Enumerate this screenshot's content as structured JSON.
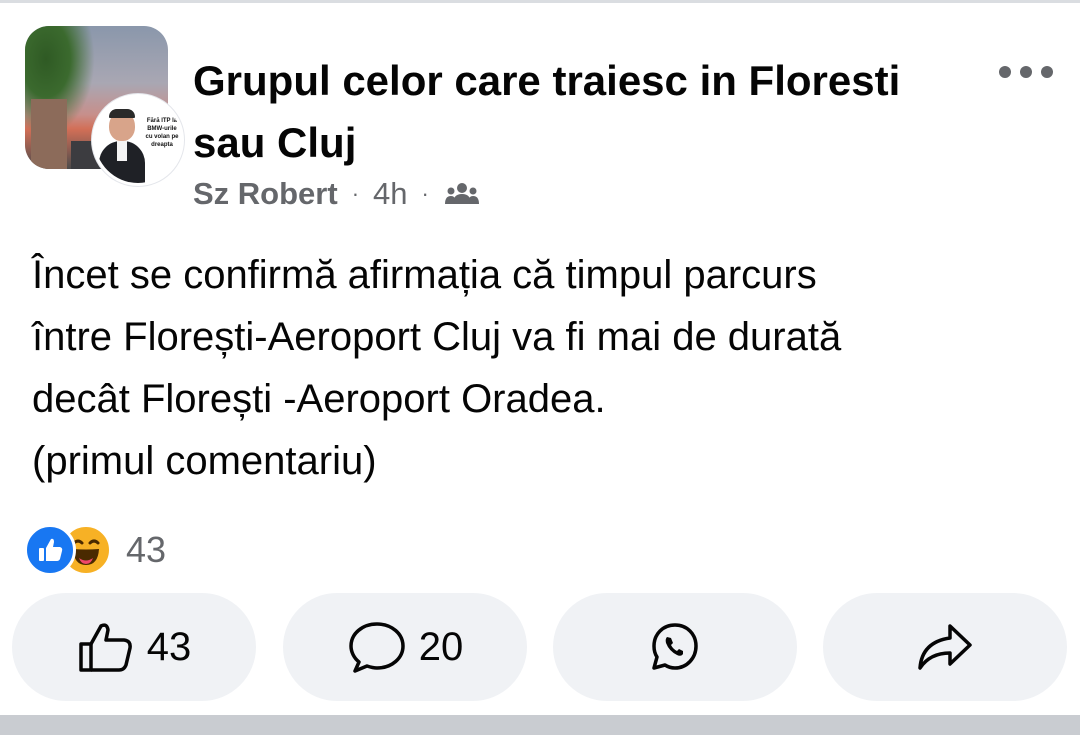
{
  "group": {
    "title": "Grupul celor care traiesc in Floresti sau Cluj",
    "avatar_icon": "group-cover-photo"
  },
  "author": {
    "name": "Sz Robert",
    "time": "4h",
    "separator": "·",
    "audience_icon": "group-members-icon",
    "avatar_caption": "Fără ITP la BMW-urile cu volan pe dreapta"
  },
  "post": {
    "text": "Încet se confirmă afirmația că timpul parcurs\nîntre Florești-Aeroport Cluj va fi mai de durată\ndecât Florești -Aeroport Oradea.\n(primul comentariu)"
  },
  "reactions": {
    "types": [
      "like",
      "haha"
    ],
    "count": "43"
  },
  "actions": {
    "like": {
      "icon": "thumbs-up-icon",
      "label": "43"
    },
    "comment": {
      "icon": "comment-bubble-icon",
      "label": "20"
    },
    "whatsapp": {
      "icon": "whatsapp-icon"
    },
    "share": {
      "icon": "share-arrow-icon"
    }
  },
  "colors": {
    "text_primary": "#050505",
    "text_secondary": "#65676b",
    "button_bg": "#f0f2f5",
    "like_blue": "#1877f2",
    "haha_yellow": "#f7b125"
  }
}
